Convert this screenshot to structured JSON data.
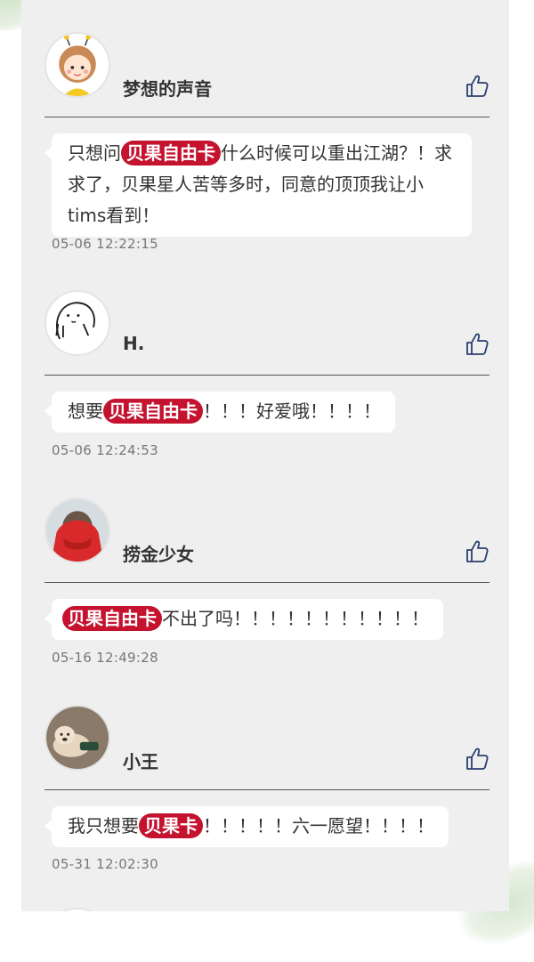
{
  "comments": [
    {
      "username": "梦想的声音",
      "avatar_icon": "cartoon-girl-avatar",
      "text_before": "只想问",
      "highlight": "贝果自由卡",
      "text_after": "什么时候可以重出江湖？！求求了，贝果星人苦等多时，同意的顶顶我让小tims看到！",
      "timestamp": "05-06  12:22:15"
    },
    {
      "username": "H.",
      "avatar_icon": "doodle-face-avatar",
      "text_before": "想要",
      "highlight": "贝果自由卡",
      "text_after": "！！！好爱哦！！！！",
      "timestamp": "05-06  12:24:53"
    },
    {
      "username": "捞金少女",
      "avatar_icon": "red-scarf-photo-avatar",
      "text_before": "",
      "highlight": "贝果自由卡",
      "text_after": "不出了吗！！！！！！！！！！！",
      "timestamp": "05-16  12:49:28"
    },
    {
      "username": "小王",
      "avatar_icon": "dog-photo-avatar",
      "text_before": "我只想要",
      "highlight": "贝果卡",
      "text_after": "！！！！！六一愿望！！！！",
      "timestamp": "05-31  12:02:30"
    }
  ],
  "like_icon": "thumbs-up-icon",
  "colors": {
    "highlight_bg": "#c4122f",
    "panel_bg": "#efefef",
    "like_icon": "#2c3e70"
  }
}
